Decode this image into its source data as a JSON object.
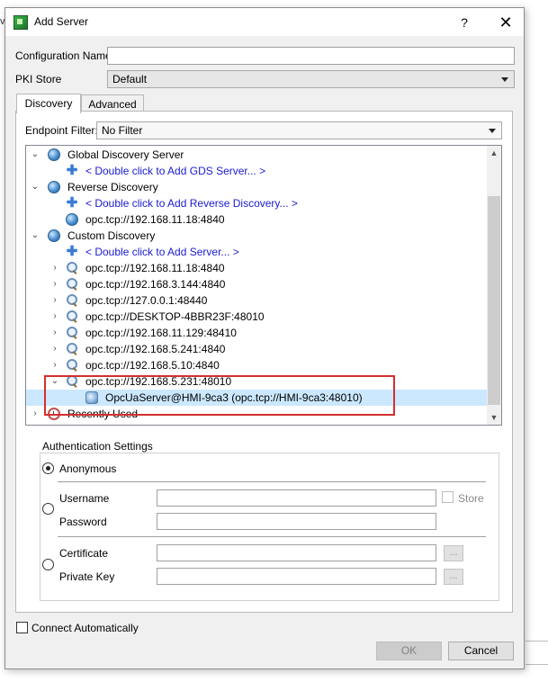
{
  "background": {
    "edge_text": "va"
  },
  "dialog": {
    "title": "Add Server",
    "help_label": "?",
    "close_label": "✕"
  },
  "form": {
    "config_name_label": "Configuration Name",
    "config_name_value": "",
    "pki_store_label": "PKI Store",
    "pki_store_value": "Default"
  },
  "tabs": [
    {
      "label": "Discovery",
      "active": true
    },
    {
      "label": "Advanced",
      "active": false
    }
  ],
  "endpoint_filter": {
    "label": "Endpoint Filter:",
    "value": "No Filter"
  },
  "tree": {
    "items": [
      {
        "kind": "root",
        "text": "Global Discovery Server"
      },
      {
        "kind": "add",
        "text": "< Double click to Add GDS Server... >"
      },
      {
        "kind": "root",
        "text": "Reverse Discovery"
      },
      {
        "kind": "add",
        "text": "< Double click to Add Reverse Discovery... >"
      },
      {
        "kind": "endpoint",
        "text": "opc.tcp://192.168.11.18:4840"
      },
      {
        "kind": "root",
        "text": "Custom Discovery"
      },
      {
        "kind": "add",
        "text": "< Double click to Add Server... >"
      },
      {
        "kind": "search",
        "text": "opc.tcp://192.168.11.18:4840"
      },
      {
        "kind": "search",
        "text": "opc.tcp://192.168.3.144:4840"
      },
      {
        "kind": "search",
        "text": "opc.tcp://127.0.0.1:48440"
      },
      {
        "kind": "search",
        "text": "opc.tcp://DESKTOP-4BBR23F:48010"
      },
      {
        "kind": "search",
        "text": "opc.tcp://192.168.11.129:48410"
      },
      {
        "kind": "search",
        "text": "opc.tcp://192.168.5.241:4840"
      },
      {
        "kind": "search",
        "text": "opc.tcp://192.168.5.10:4840"
      },
      {
        "kind": "search-open",
        "text": "opc.tcp://192.168.5.231:48010"
      },
      {
        "kind": "server",
        "text": "OpcUaServer@HMI-9ca3 (opc.tcp://HMI-9ca3:48010)"
      },
      {
        "kind": "recent",
        "text": "Recently Used"
      }
    ]
  },
  "auth": {
    "title": "Authentication Settings",
    "anonymous_label": "Anonymous",
    "username_label": "Username",
    "password_label": "Password",
    "store_label": "Store",
    "certificate_label": "Certificate",
    "private_key_label": "Private Key",
    "browse_label": "..."
  },
  "footer": {
    "connect_auto_label": "Connect Automatically",
    "ok_label": "OK",
    "cancel_label": "Cancel"
  }
}
